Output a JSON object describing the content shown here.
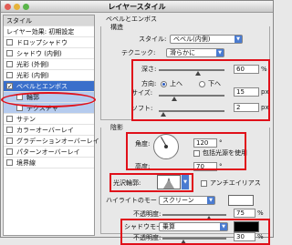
{
  "window": {
    "title": "レイヤースタイル"
  },
  "left": {
    "header": "スタイル",
    "blend_default": "レイヤー効果: 初期設定",
    "items": [
      {
        "label": "ドロップシャドウ",
        "checked": false
      },
      {
        "label": "シャドウ (内側)",
        "checked": false
      },
      {
        "label": "光彩 (外側)",
        "checked": false
      },
      {
        "label": "光彩 (内側)",
        "checked": false
      },
      {
        "label": "ベベルとエンボス",
        "checked": true,
        "selected": true
      },
      {
        "label": "輪郭",
        "checked": false,
        "sub": true
      },
      {
        "label": "テクスチャ",
        "checked": false,
        "sub": true
      },
      {
        "label": "サテン",
        "checked": false
      },
      {
        "label": "カラーオーバーレイ",
        "checked": false
      },
      {
        "label": "グラデーションオーバーレイ",
        "checked": false
      },
      {
        "label": "パターンオーバーレイ",
        "checked": false
      },
      {
        "label": "境界線",
        "checked": false
      }
    ]
  },
  "structure": {
    "section_title": "ベベルとエンボス",
    "group_title": "構造",
    "style_label": "スタイル:",
    "style_value": "ベベル(内側)",
    "technique_label": "テクニック:",
    "technique_value": "滑らかに",
    "depth_label": "深さ:",
    "depth_value": "60",
    "depth_unit": "%",
    "depth_level": 0.6,
    "direction_label": "方向:",
    "direction_up": "上へ",
    "direction_down": "下へ",
    "size_label": "サイズ:",
    "size_value": "15",
    "size_unit": "px",
    "soften_label": "ソフト:",
    "soften_value": "2",
    "soften_unit": "px"
  },
  "shading": {
    "group_title": "陰影",
    "angle_label": "角度:",
    "angle_value": "120",
    "angle_unit": "°",
    "global_light_label": "包括光源を使用",
    "altitude_label": "高度:",
    "altitude_value": "70",
    "altitude_unit": "°",
    "gloss_label": "光沢輪郭:",
    "antialias_label": "アンチエイリアス",
    "highlight_label": "ハイライトのモード:",
    "highlight_value": "スクリーン",
    "highlight_color": "#ffffff",
    "highlight_opacity_label": "不透明度:",
    "highlight_opacity_value": "75",
    "highlight_opacity_unit": "%",
    "shadow_label": "シャドウモード:",
    "shadow_value": "乗算",
    "shadow_color": "#000000",
    "shadow_opacity_label": "不透明度:",
    "shadow_opacity_value": "30",
    "shadow_opacity_unit": "%"
  },
  "colors": {
    "accent": "#3a6fcb",
    "highlight_box": "#e0101a"
  }
}
